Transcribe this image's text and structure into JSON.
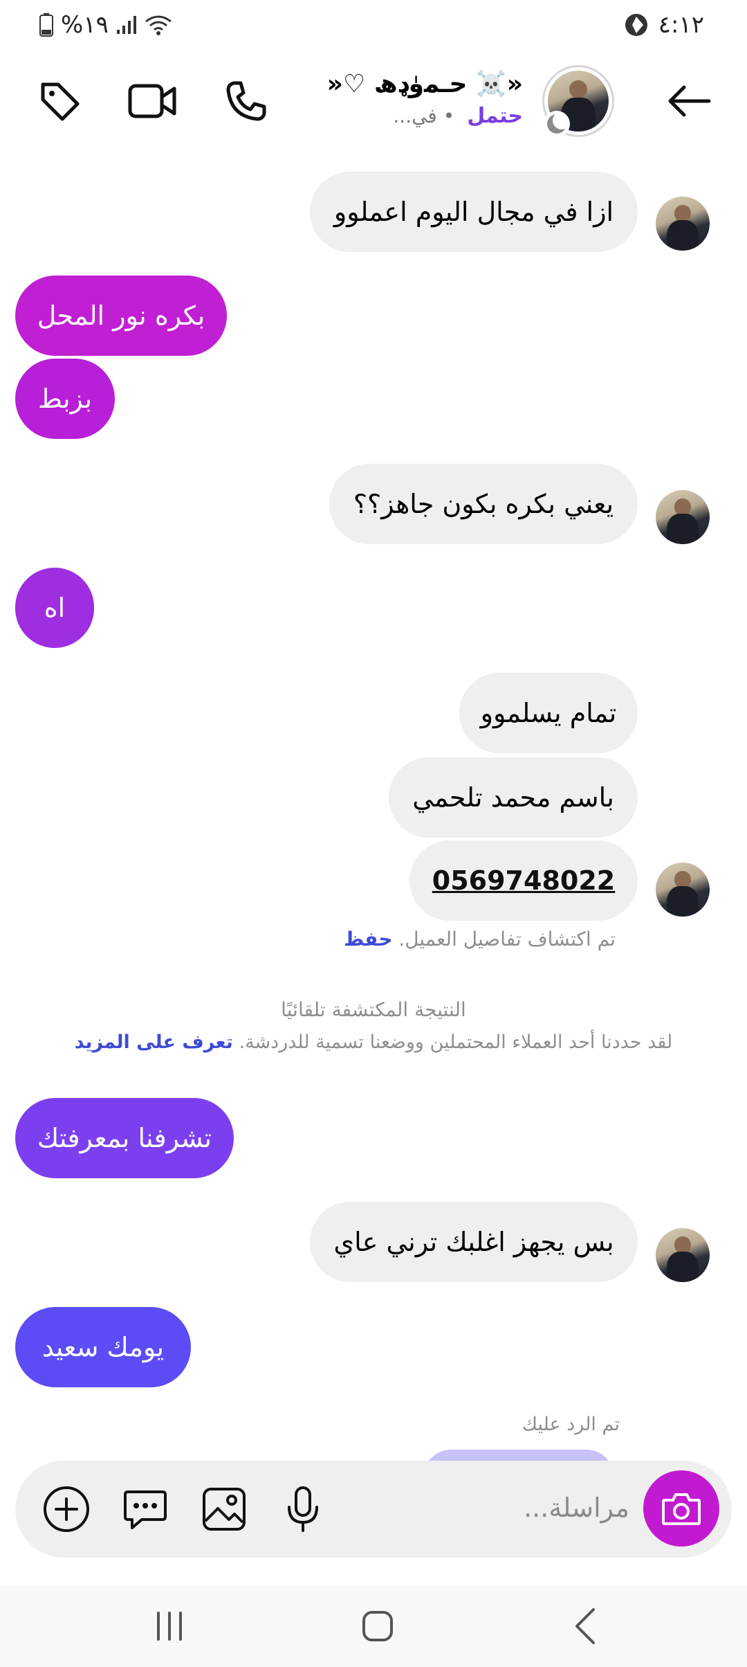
{
  "status_bar": {
    "time": "٤:١٢",
    "battery": "%١٩"
  },
  "header": {
    "contact_name": "«☠️ حـﻤﯛډھ ♡«",
    "contact_tag": "حتمل",
    "contact_status": "• في..."
  },
  "messages": [
    {
      "side": "in",
      "text": "ازا في مجال اليوم اعملوو"
    },
    {
      "side": "out",
      "text": "بكره نور المحل",
      "color": "#c11fd3"
    },
    {
      "side": "out",
      "text": "بزبط",
      "color": "#b81fd8"
    },
    {
      "side": "in",
      "text": "يعني بكره بكون جاهز؟؟"
    },
    {
      "side": "out",
      "text": "اه",
      "color": "#9e2ee0"
    },
    {
      "side": "in",
      "text": "تمام يسلموو"
    },
    {
      "side": "in",
      "text": "باسم محمد تلحمي"
    },
    {
      "side": "in",
      "text": "0569748022"
    },
    {
      "side": "out",
      "text": "تشرفنا بمعرفتك",
      "color": "#7c3ff0"
    },
    {
      "side": "in",
      "text": "بس يجهز اغلبك ترني عاي"
    },
    {
      "side": "out",
      "text": "يومك سعيد",
      "color": "#5b4cf5"
    }
  ],
  "detected": {
    "text": "تم اكتشاف تفاصيل العميل.",
    "save_label": "حفظ"
  },
  "auto_note": {
    "title": "النتيجة المكتشفة تلقائيًا",
    "body": "لقد حددنا أحد العملاء المحتملين ووضعنا تسمية للدردشة.",
    "learn_more": "تعرف على المزيد"
  },
  "replied_label": "تم الرد عليك",
  "composer": {
    "placeholder": "مراسلة..."
  },
  "colors": {
    "accent_purple": "#7a3fe0",
    "link_blue": "#3e4bd6",
    "camera": "#c21ad0"
  }
}
